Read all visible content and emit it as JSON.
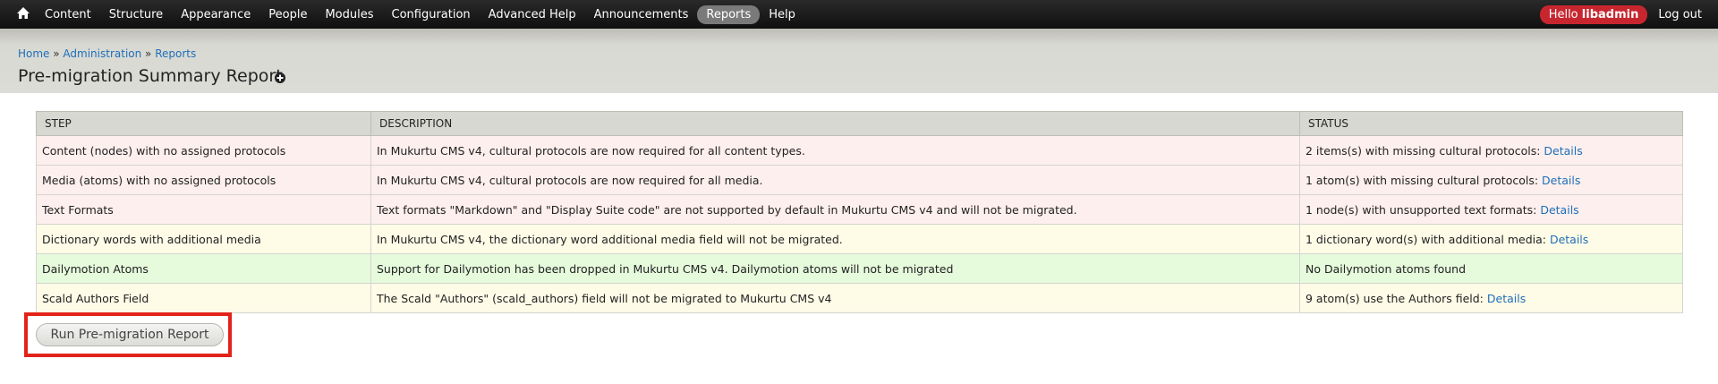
{
  "toolbar": {
    "home_icon": "home-icon",
    "items": [
      "Content",
      "Structure",
      "Appearance",
      "People",
      "Modules",
      "Configuration",
      "Advanced Help",
      "Announcements",
      "Reports",
      "Help"
    ],
    "active_item": "Reports",
    "hello_prefix": "Hello ",
    "username": "libadmin",
    "logout": "Log out",
    "hello_color": "#c8262f"
  },
  "breadcrumb": {
    "home": "Home",
    "sep1": " » ",
    "administration": "Administration",
    "sep2": " » ",
    "reports": "Reports"
  },
  "page": {
    "title": "Pre-migration Summary Report",
    "shortcut_icon": "add-shortcut-icon"
  },
  "table": {
    "headers": {
      "step": "STEP",
      "description": "DESCRIPTION",
      "status": "STATUS"
    },
    "rows": [
      {
        "step": "Content (nodes) with no assigned protocols",
        "description": "In Mukurtu CMS v4, cultural protocols are now required for all content types.",
        "status": "2 items(s) with missing cultural protocols: ",
        "link": "Details",
        "level": "red"
      },
      {
        "step": "Media (atoms) with no assigned protocols",
        "description": "In Mukurtu CMS v4, cultural protocols are now required for all media.",
        "status": "1 atom(s) with missing cultural protocols: ",
        "link": "Details",
        "level": "red"
      },
      {
        "step": "Text Formats",
        "description": "Text formats \"Markdown\" and \"Display Suite code\" are not supported by default in Mukurtu CMS v4 and will not be migrated.",
        "status": "1 node(s) with unsupported text formats: ",
        "link": "Details",
        "level": "red"
      },
      {
        "step": "Dictionary words with additional media",
        "description": "In Mukurtu CMS v4, the dictionary word additional media field will not be migrated.",
        "status": "1 dictionary word(s) with additional media: ",
        "link": "Details",
        "level": "yellow"
      },
      {
        "step": "Dailymotion Atoms",
        "description": "Support for Dailymotion has been dropped in Mukurtu CMS v4. Dailymotion atoms will not be migrated",
        "status": "No Dailymotion atoms found",
        "link": "",
        "level": "green"
      },
      {
        "step": "Scald Authors Field",
        "description": "The Scald \"Authors\" (scald_authors) field will not be migrated to Mukurtu CMS v4",
        "status": "9 atom(s) use the Authors field: ",
        "link": "Details",
        "level": "yellow"
      }
    ],
    "colors": {
      "red": "#fdefed",
      "yellow": "#fefbe7",
      "green": "#e6fadc",
      "link": "#1e6fb8"
    }
  },
  "actions": {
    "run_button": "Run Pre-migration Report",
    "highlight_color": "#e2231a"
  }
}
